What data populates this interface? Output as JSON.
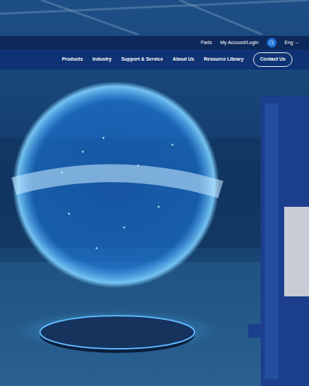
{
  "header": {
    "utility_links": [
      "Parts",
      "My Account/Login"
    ],
    "language": "Eng"
  },
  "nav": {
    "items": [
      "Products",
      "Industry",
      "Support & Service",
      "About Us",
      "Resource Library"
    ],
    "contact_button": "Contact Us"
  }
}
